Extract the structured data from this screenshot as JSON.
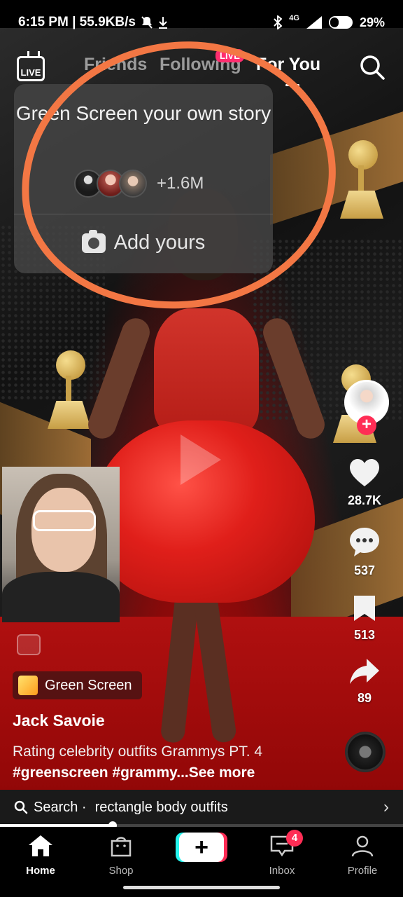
{
  "status_bar": {
    "time_speed": "6:15 PM | 55.9KB/s",
    "network": "4G",
    "battery": "29%"
  },
  "top_nav": {
    "live_label": "LIVE",
    "tabs": [
      "Friends",
      "Following",
      "For You"
    ],
    "active_tab": "For You",
    "live_badge": "LIVE"
  },
  "popup": {
    "title": "Green Screen your own story",
    "participants_count": "+1.6M",
    "action_label": "Add yours"
  },
  "annotation": {
    "color": "#f37744"
  },
  "right_rail": {
    "likes": "28.7K",
    "comments": "537",
    "saves": "513",
    "shares": "89"
  },
  "caption": {
    "effect_label": "Green Screen",
    "author": "Jack Savoie",
    "text": "Rating celebrity outfits Grammys PT. 4",
    "tags": "#greenscreen #grammy...",
    "see_more": "See more"
  },
  "search_suggestion": {
    "prefix": "Search ·",
    "query": "rectangle body outfits"
  },
  "progress": {
    "fraction": 0.28
  },
  "bottom_nav": {
    "items": [
      "Home",
      "Shop",
      "",
      "Inbox",
      "Profile"
    ],
    "inbox_badge": "4",
    "active": "Home"
  },
  "colors": {
    "accent_pink": "#fe2c55",
    "accent_cyan": "#25f4ee",
    "dress_red": "#e01f1a"
  }
}
